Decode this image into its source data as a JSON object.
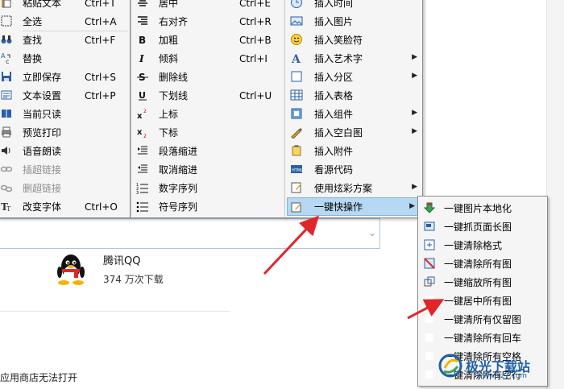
{
  "menu1": {
    "items": [
      {
        "label": "粘贴文本",
        "shortcut": "Ctrl+T",
        "icon": "paste-text-icon",
        "enabled": true
      },
      {
        "label": "全选",
        "shortcut": "Ctrl+A",
        "icon": "select-all-icon",
        "enabled": true
      },
      {
        "label": "查找",
        "shortcut": "Ctrl+F",
        "icon": "find-binoculars-icon",
        "enabled": true
      },
      {
        "label": "替换",
        "shortcut": "",
        "icon": "replace-icon",
        "enabled": true
      },
      {
        "label": "立即保存",
        "shortcut": "Ctrl+S",
        "icon": "save-disk-icon",
        "enabled": true
      },
      {
        "label": "文本设置",
        "shortcut": "Ctrl+P",
        "icon": "text-settings-icon",
        "enabled": true
      },
      {
        "label": "当前只读",
        "shortcut": "",
        "icon": "read-only-book-icon",
        "enabled": true
      },
      {
        "label": "预览打印",
        "shortcut": "",
        "icon": "print-preview-icon",
        "enabled": true
      },
      {
        "label": "语音朗读",
        "shortcut": "",
        "icon": "speaker-icon",
        "enabled": true
      },
      {
        "label": "插超链接",
        "shortcut": "",
        "icon": "link-insert-icon",
        "enabled": false
      },
      {
        "label": "删超链接",
        "shortcut": "",
        "icon": "link-remove-icon",
        "enabled": false
      },
      {
        "label": "改变字体",
        "shortcut": "Ctrl+O",
        "icon": "font-change-icon",
        "enabled": true
      }
    ]
  },
  "menu2": {
    "items": [
      {
        "label": "居中",
        "shortcut": "Ctrl+E",
        "icon": "align-center-icon"
      },
      {
        "label": "右对齐",
        "shortcut": "Ctrl+R",
        "icon": "align-right-icon"
      },
      {
        "label": "加粗",
        "shortcut": "Ctrl+B",
        "icon": "bold-icon"
      },
      {
        "label": "倾斜",
        "shortcut": "Ctrl+I",
        "icon": "italic-icon"
      },
      {
        "label": "删除线",
        "shortcut": "",
        "icon": "strikethrough-icon"
      },
      {
        "label": "下划线",
        "shortcut": "Ctrl+U",
        "icon": "underline-icon"
      },
      {
        "label": "上标",
        "shortcut": "",
        "icon": "superscript-icon"
      },
      {
        "label": "下标",
        "shortcut": "",
        "icon": "subscript-icon"
      },
      {
        "label": "段落缩进",
        "shortcut": "",
        "icon": "indent-icon"
      },
      {
        "label": "取消缩进",
        "shortcut": "",
        "icon": "outdent-icon"
      },
      {
        "label": "数字序列",
        "shortcut": "",
        "icon": "numbered-list-icon"
      },
      {
        "label": "符号序列",
        "shortcut": "",
        "icon": "bulleted-list-icon"
      }
    ]
  },
  "menu3": {
    "items": [
      {
        "label": "插入时间",
        "icon": "clock-icon",
        "submenu": false
      },
      {
        "label": "插入图片",
        "icon": "picture-icon",
        "submenu": false
      },
      {
        "label": "插入笑脸符",
        "icon": "smiley-icon",
        "submenu": false
      },
      {
        "label": "插入艺术字",
        "icon": "word-art-icon",
        "submenu": true
      },
      {
        "label": "插入分区",
        "icon": "section-icon",
        "submenu": true
      },
      {
        "label": "插入表格",
        "icon": "table-icon",
        "submenu": false
      },
      {
        "label": "插入组件",
        "icon": "component-icon",
        "submenu": true
      },
      {
        "label": "插入空白图",
        "icon": "blank-image-pen-icon",
        "submenu": true
      },
      {
        "label": "插入附件",
        "icon": "attachment-icon",
        "submenu": false
      },
      {
        "label": "看源代码",
        "icon": "html-source-icon",
        "submenu": false
      },
      {
        "label": "使用炫彩方案",
        "icon": "color-scheme-icon",
        "submenu": true
      },
      {
        "label": "一键快操作",
        "icon": "quick-action-icon",
        "submenu": true,
        "active": true
      }
    ]
  },
  "menu4": {
    "items": [
      {
        "label": "一键图片本地化",
        "icon": "download-arrow-icon"
      },
      {
        "label": "一键抓页面长图",
        "icon": "screenshot-icon"
      },
      {
        "label": "一键清除格式",
        "icon": "clear-format-icon"
      },
      {
        "label": "一键清除所有图",
        "icon": "remove-images-icon"
      },
      {
        "label": "一键缩放所有图",
        "icon": "scale-images-icon"
      },
      {
        "label": "一键居中所有图",
        "icon": "center-images-icon"
      },
      {
        "label": "一键清所有仅留图",
        "icon": "keep-images-icon"
      },
      {
        "label": "一键清除所有回车",
        "icon": "remove-newlines-icon"
      },
      {
        "label": "一键清除所有空格",
        "icon": "remove-spaces-icon"
      },
      {
        "label": "一键清除所有空行",
        "icon": "remove-blank-lines-icon"
      }
    ]
  },
  "background": {
    "app_name": "腾讯QQ",
    "downloads": "374 万次下载",
    "note": "应用商店无法打开"
  },
  "watermark": {
    "text": "极光下载站",
    "url": "www.xz7.com"
  },
  "colors": {
    "menu_bg": "#f5f5f5",
    "highlight": "#b7d8f3",
    "arrow": "#e0262a"
  }
}
